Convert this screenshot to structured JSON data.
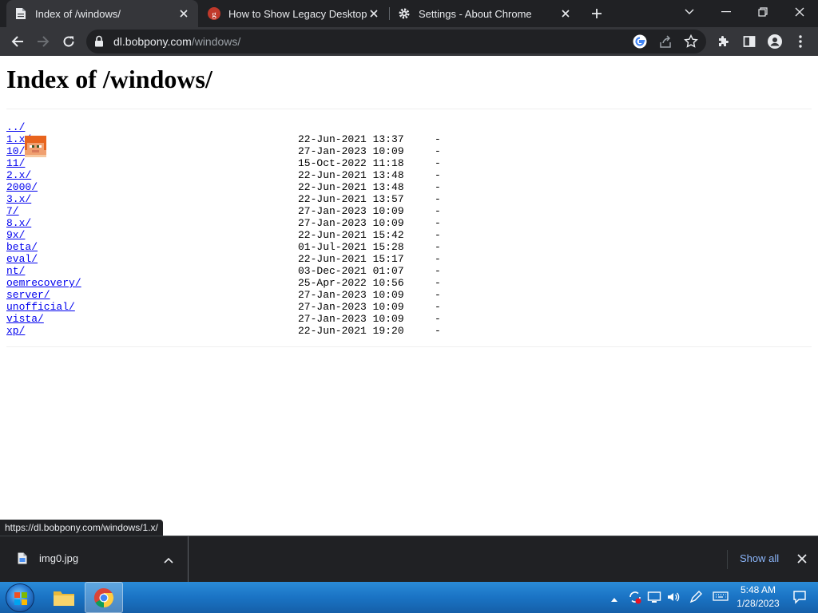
{
  "browser": {
    "tabs": [
      {
        "title": "Index of /windows/",
        "favicon": "page-icon",
        "active": true
      },
      {
        "title": "How to Show Legacy Desktop Icons",
        "favicon": "groovypost-icon",
        "active": false
      },
      {
        "title": "Settings - About Chrome",
        "favicon": "gear-icon",
        "active": false
      }
    ],
    "omnibox": {
      "host": "dl.bobpony.com",
      "path": "/windows/"
    }
  },
  "page": {
    "title": "Index of /windows/",
    "parent_link": "../",
    "entries": [
      {
        "name": "1.x/",
        "date": "22-Jun-2021 13:37",
        "size": "-"
      },
      {
        "name": "10/",
        "date": "27-Jan-2023 10:09",
        "size": "-"
      },
      {
        "name": "11/",
        "date": "15-Oct-2022 11:18",
        "size": "-"
      },
      {
        "name": "2.x/",
        "date": "22-Jun-2021 13:48",
        "size": "-"
      },
      {
        "name": "2000/",
        "date": "22-Jun-2021 13:48",
        "size": "-"
      },
      {
        "name": "3.x/",
        "date": "22-Jun-2021 13:57",
        "size": "-"
      },
      {
        "name": "7/",
        "date": "27-Jan-2023 10:09",
        "size": "-"
      },
      {
        "name": "8.x/",
        "date": "27-Jan-2023 10:09",
        "size": "-"
      },
      {
        "name": "9x/",
        "date": "22-Jun-2021 15:42",
        "size": "-"
      },
      {
        "name": "beta/",
        "date": "01-Jul-2021 15:28",
        "size": "-"
      },
      {
        "name": "eval/",
        "date": "22-Jun-2021 15:17",
        "size": "-"
      },
      {
        "name": "nt/",
        "date": "03-Dec-2021 01:07",
        "size": "-"
      },
      {
        "name": "oemrecovery/",
        "date": "25-Apr-2022 10:56",
        "size": "-"
      },
      {
        "name": "server/",
        "date": "27-Jan-2023 10:09",
        "size": "-"
      },
      {
        "name": "unofficial/",
        "date": "27-Jan-2023 10:09",
        "size": "-"
      },
      {
        "name": "vista/",
        "date": "27-Jan-2023 10:09",
        "size": "-"
      },
      {
        "name": "xp/",
        "date": "22-Jun-2021 19:20",
        "size": "-"
      }
    ]
  },
  "status_bubble": "https://dl.bobpony.com/windows/1.x/",
  "downloads": {
    "file_name": "img0.jpg",
    "show_all_label": "Show all"
  },
  "taskbar": {
    "time": "5:48 AM",
    "date": "1/28/2023"
  },
  "colors": {
    "link": "#0000ee",
    "chrome_dark": "#202124",
    "chrome_active_tab": "#35363a",
    "taskbar_blue": "#1a73c4",
    "show_all_blue": "#8ab4f8"
  }
}
